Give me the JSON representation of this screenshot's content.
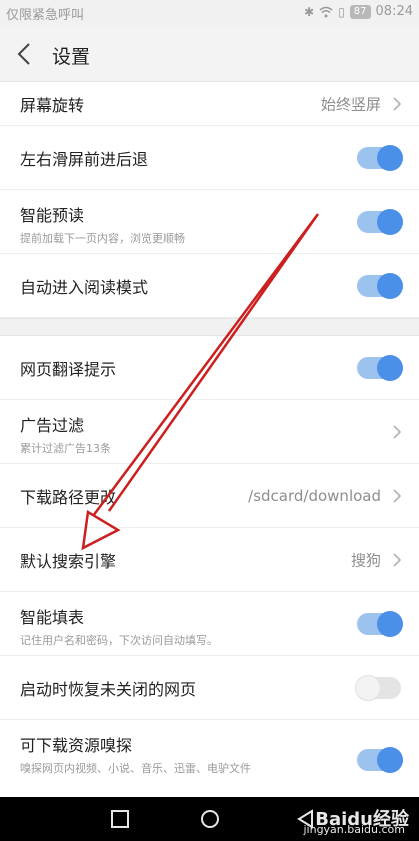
{
  "status_bar": {
    "carrier": "仅限紧急呼叫",
    "battery": "87",
    "time": "08:24",
    "icons": [
      "bluetooth-icon",
      "wifi-icon",
      "sim-icon",
      "battery-icon"
    ]
  },
  "header": {
    "title": "设置",
    "back_icon": "back-arrow-icon"
  },
  "settings": {
    "screen_rotation": {
      "title": "屏幕旋转",
      "value": "始终竖屏"
    },
    "swipe_nav": {
      "title": "左右滑屏前进后退",
      "enabled": true
    },
    "preload": {
      "title": "智能预读",
      "subtitle": "提前加载下一页内容，浏览更顺畅",
      "enabled": true
    },
    "reader_mode": {
      "title": "自动进入阅读模式",
      "enabled": true
    },
    "translate": {
      "title": "网页翻译提示",
      "enabled": true
    },
    "ad_filter": {
      "title": "广告过滤",
      "subtitle": "累计过滤广告13条"
    },
    "download_path": {
      "title": "下载路径更改",
      "value": "/sdcard/download"
    },
    "search_engine": {
      "title": "默认搜索引擎",
      "value": "搜狗"
    },
    "autofill": {
      "title": "智能填表",
      "subtitle": "记住用户名和密码，下次访问自动填写。",
      "enabled": true
    },
    "restore_pages": {
      "title": "启动时恢复未关闭的网页",
      "enabled": false
    },
    "resource_sniff": {
      "title": "可下载资源嗅探",
      "subtitle": "嗅探网页内视频、小说、音乐、迅雷、电驴文件",
      "enabled": true
    }
  },
  "nav_bar": {
    "buttons": [
      "back-triangle-icon",
      "home-circle-icon",
      "recents-square-icon"
    ]
  },
  "watermark": {
    "brand": "Baidu经验",
    "url": "jingyan.baidu.com"
  },
  "colors": {
    "accent": "#4a8fe8",
    "track_on": "#9cc2ee",
    "annotation": "#cc1f1f"
  }
}
